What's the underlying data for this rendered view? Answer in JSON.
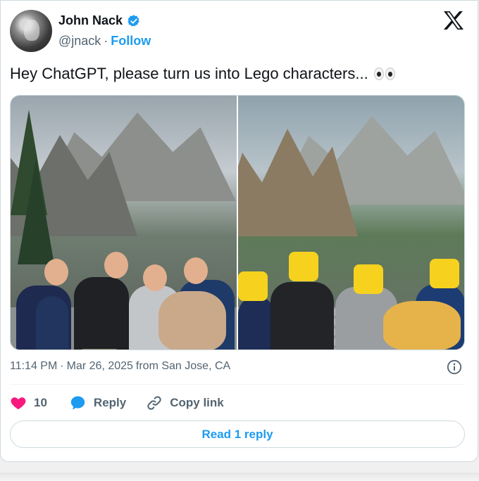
{
  "author": {
    "name": "John Nack",
    "handle": "@jnack",
    "separator": "·",
    "follow_label": "Follow"
  },
  "tweet": {
    "text": "Hey ChatGPT, please turn us into Lego characters...",
    "emoji": "eyes-emoji"
  },
  "media": {
    "left_photo": "family-photo-yosemite",
    "right_photo": "lego-version-photo"
  },
  "meta": {
    "time": "11:14 PM",
    "separator": "·",
    "date": "Mar 26, 2025",
    "source": "from San Jose, CA"
  },
  "actions": {
    "like_count": "10",
    "reply_label": "Reply",
    "copy_label": "Copy link"
  },
  "read_replies_label": "Read 1 reply",
  "colors": {
    "accent": "#1d9bf0",
    "like": "#f91880",
    "text": "#0f1419",
    "muted": "#536471"
  },
  "icons": [
    "verified-badge-icon",
    "x-logo-icon",
    "info-icon",
    "heart-icon",
    "reply-bubble-icon",
    "link-icon"
  ]
}
